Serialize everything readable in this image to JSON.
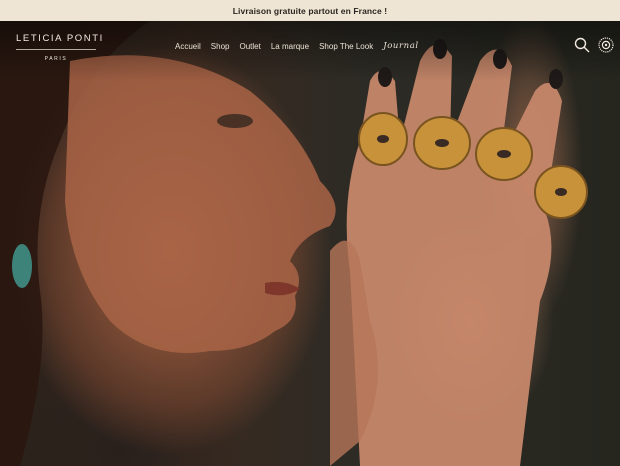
{
  "announcement": {
    "text": "Livraison gratuite partout en France !"
  },
  "brand": {
    "name": "LETICIA PONTI",
    "city": "PARIS"
  },
  "nav": {
    "items": [
      {
        "label": "Accueil"
      },
      {
        "label": "Shop"
      },
      {
        "label": "Outlet"
      },
      {
        "label": "La marque"
      },
      {
        "label": "Shop The Look"
      },
      {
        "label": "Journal"
      }
    ]
  },
  "icons": {
    "search": "search-icon",
    "account": "account-sun-icon"
  },
  "colors": {
    "announcement_bg": "#efe5d4",
    "header_text": "#f2ebe1",
    "gold": "#c8923a"
  }
}
